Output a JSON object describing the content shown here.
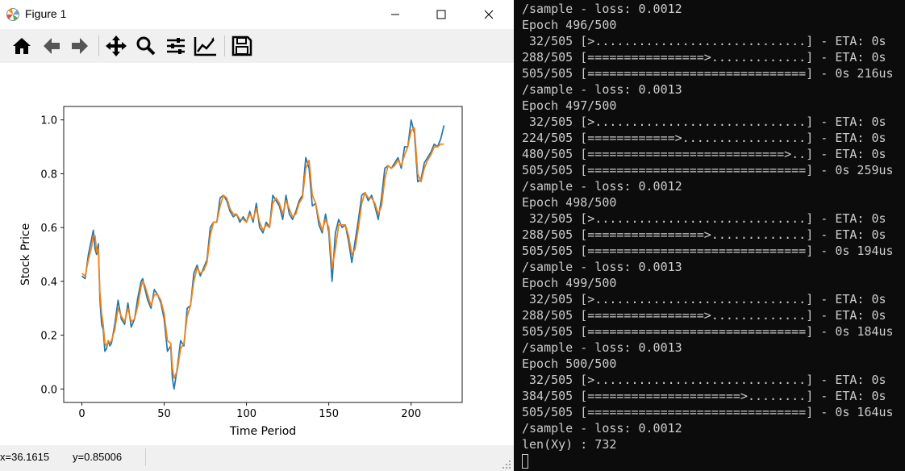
{
  "window": {
    "title": "Figure 1",
    "minimize_glyph": "—",
    "maximize_glyph": "☐",
    "close_glyph": "✕"
  },
  "toolbar": {
    "icons": [
      "home-icon",
      "back-arrow-icon",
      "forward-arrow-icon",
      "pan-icon",
      "zoom-icon",
      "subplots-config-icon",
      "edit-axis-icon",
      "save-icon"
    ]
  },
  "status": {
    "x_readout": "x=36.1615",
    "y_readout": "y=0.85006"
  },
  "colors": {
    "series_actual": "#1f77b4",
    "series_predicted": "#ff7f0e",
    "terminal_bg": "#0c0c0c",
    "terminal_fg": "#cccccc"
  },
  "chart_data": {
    "type": "line",
    "title": "",
    "xlabel": "Time Period",
    "ylabel": "Stock Price",
    "xlim": [
      -11,
      231
    ],
    "ylim": [
      -0.05,
      1.05
    ],
    "xticks": [
      0,
      50,
      100,
      150,
      200
    ],
    "yticks": [
      0.0,
      0.2,
      0.4,
      0.6,
      0.8,
      1.0
    ],
    "xtick_labels": [
      "0",
      "50",
      "100",
      "150",
      "200"
    ],
    "ytick_labels": [
      "0.0",
      "0.2",
      "0.4",
      "0.6",
      "0.8",
      "1.0"
    ],
    "grid": false,
    "legend": "none",
    "series": [
      {
        "color": "#1f77b4",
        "x": [
          0,
          2,
          4,
          6,
          7,
          8,
          9,
          10,
          11,
          12,
          13,
          14,
          15,
          16,
          17,
          18,
          20,
          22,
          24,
          26,
          28,
          30,
          32,
          34,
          36,
          37,
          38,
          40,
          42,
          44,
          46,
          48,
          50,
          52,
          54,
          55,
          56,
          58,
          60,
          62,
          64,
          66,
          68,
          70,
          72,
          74,
          76,
          78,
          80,
          82,
          84,
          86,
          88,
          90,
          92,
          94,
          96,
          98,
          100,
          102,
          104,
          106,
          108,
          110,
          112,
          114,
          116,
          118,
          120,
          122,
          124,
          126,
          128,
          130,
          132,
          134,
          136,
          138,
          140,
          142,
          144,
          146,
          148,
          150,
          152,
          154,
          156,
          158,
          160,
          162,
          164,
          166,
          168,
          170,
          172,
          174,
          176,
          178,
          180,
          182,
          184,
          186,
          188,
          190,
          192,
          194,
          196,
          198,
          200,
          202,
          204,
          206,
          208,
          210,
          212,
          214,
          216,
          218,
          220
        ],
        "y": [
          0.42,
          0.41,
          0.5,
          0.56,
          0.59,
          0.52,
          0.5,
          0.54,
          0.33,
          0.24,
          0.22,
          0.14,
          0.15,
          0.18,
          0.16,
          0.17,
          0.24,
          0.33,
          0.26,
          0.24,
          0.32,
          0.23,
          0.26,
          0.34,
          0.4,
          0.41,
          0.38,
          0.33,
          0.3,
          0.37,
          0.35,
          0.32,
          0.26,
          0.14,
          0.16,
          0.04,
          0.0,
          0.08,
          0.18,
          0.16,
          0.3,
          0.31,
          0.43,
          0.46,
          0.42,
          0.45,
          0.48,
          0.6,
          0.62,
          0.62,
          0.71,
          0.72,
          0.7,
          0.66,
          0.64,
          0.65,
          0.62,
          0.64,
          0.62,
          0.66,
          0.62,
          0.69,
          0.6,
          0.58,
          0.62,
          0.6,
          0.72,
          0.7,
          0.68,
          0.63,
          0.72,
          0.65,
          0.63,
          0.66,
          0.7,
          0.72,
          0.86,
          0.82,
          0.68,
          0.69,
          0.61,
          0.58,
          0.65,
          0.58,
          0.4,
          0.58,
          0.63,
          0.6,
          0.61,
          0.55,
          0.47,
          0.55,
          0.63,
          0.72,
          0.73,
          0.7,
          0.72,
          0.68,
          0.63,
          0.71,
          0.82,
          0.83,
          0.82,
          0.84,
          0.86,
          0.82,
          0.9,
          0.9,
          1.0,
          0.95,
          0.77,
          0.78,
          0.84,
          0.86,
          0.88,
          0.91,
          0.9,
          0.93,
          0.98
        ]
      },
      {
        "color": "#ff7f0e",
        "x": [
          0,
          2,
          4,
          6,
          7,
          8,
          9,
          10,
          11,
          12,
          13,
          14,
          15,
          16,
          17,
          18,
          20,
          22,
          24,
          26,
          28,
          30,
          32,
          34,
          36,
          37,
          38,
          40,
          42,
          44,
          46,
          48,
          50,
          52,
          54,
          55,
          56,
          58,
          60,
          62,
          64,
          66,
          68,
          70,
          72,
          74,
          76,
          78,
          80,
          82,
          84,
          86,
          88,
          90,
          92,
          94,
          96,
          98,
          100,
          102,
          104,
          106,
          108,
          110,
          112,
          114,
          116,
          118,
          120,
          122,
          124,
          126,
          128,
          130,
          132,
          134,
          136,
          138,
          140,
          142,
          144,
          146,
          148,
          150,
          152,
          154,
          156,
          158,
          160,
          162,
          164,
          166,
          168,
          170,
          172,
          174,
          176,
          178,
          180,
          182,
          184,
          186,
          188,
          190,
          192,
          194,
          196,
          198,
          200,
          202,
          204,
          206,
          208,
          210,
          212,
          214,
          216,
          218,
          220
        ],
        "y": [
          0.43,
          0.42,
          0.48,
          0.53,
          0.57,
          0.57,
          0.51,
          0.52,
          0.36,
          0.28,
          0.24,
          0.17,
          0.16,
          0.18,
          0.17,
          0.18,
          0.22,
          0.3,
          0.27,
          0.25,
          0.3,
          0.25,
          0.26,
          0.31,
          0.38,
          0.4,
          0.39,
          0.35,
          0.31,
          0.35,
          0.35,
          0.33,
          0.28,
          0.18,
          0.17,
          0.08,
          0.04,
          0.07,
          0.15,
          0.17,
          0.27,
          0.31,
          0.4,
          0.45,
          0.43,
          0.44,
          0.47,
          0.57,
          0.62,
          0.62,
          0.68,
          0.72,
          0.71,
          0.67,
          0.65,
          0.65,
          0.63,
          0.63,
          0.62,
          0.65,
          0.63,
          0.67,
          0.62,
          0.59,
          0.61,
          0.6,
          0.69,
          0.71,
          0.69,
          0.65,
          0.7,
          0.67,
          0.64,
          0.65,
          0.69,
          0.71,
          0.82,
          0.85,
          0.72,
          0.69,
          0.63,
          0.59,
          0.63,
          0.6,
          0.45,
          0.52,
          0.61,
          0.61,
          0.61,
          0.57,
          0.5,
          0.52,
          0.6,
          0.69,
          0.73,
          0.71,
          0.71,
          0.69,
          0.65,
          0.68,
          0.78,
          0.83,
          0.82,
          0.83,
          0.85,
          0.83,
          0.87,
          0.9,
          0.96,
          0.97,
          0.8,
          0.77,
          0.82,
          0.85,
          0.87,
          0.9,
          0.9,
          0.91,
          0.91
        ]
      }
    ]
  },
  "terminal": {
    "lines": [
      "/sample - loss: 0.0012",
      "Epoch 496/500",
      " 32/505 [>.............................] - ETA: 0s",
      "288/505 [================>.............] - ETA: 0s",
      "505/505 [==============================] - 0s 216us",
      "/sample - loss: 0.0013",
      "Epoch 497/500",
      " 32/505 [>.............................] - ETA: 0s",
      "224/505 [============>.................] - ETA: 0s",
      "480/505 [===========================>..] - ETA: 0s",
      "505/505 [==============================] - 0s 259us",
      "/sample - loss: 0.0012",
      "Epoch 498/500",
      " 32/505 [>.............................] - ETA: 0s",
      "288/505 [================>.............] - ETA: 0s",
      "505/505 [==============================] - 0s 194us",
      "/sample - loss: 0.0013",
      "Epoch 499/500",
      " 32/505 [>.............................] - ETA: 0s",
      "288/505 [================>.............] - ETA: 0s",
      "505/505 [==============================] - 0s 184us",
      "/sample - loss: 0.0013",
      "Epoch 500/500",
      " 32/505 [>.............................] - ETA: 0s",
      "384/505 [=====================>........] - ETA: 0s",
      "505/505 [==============================] - 0s 164us",
      "/sample - loss: 0.0012",
      "len(Xy) : 732"
    ]
  }
}
